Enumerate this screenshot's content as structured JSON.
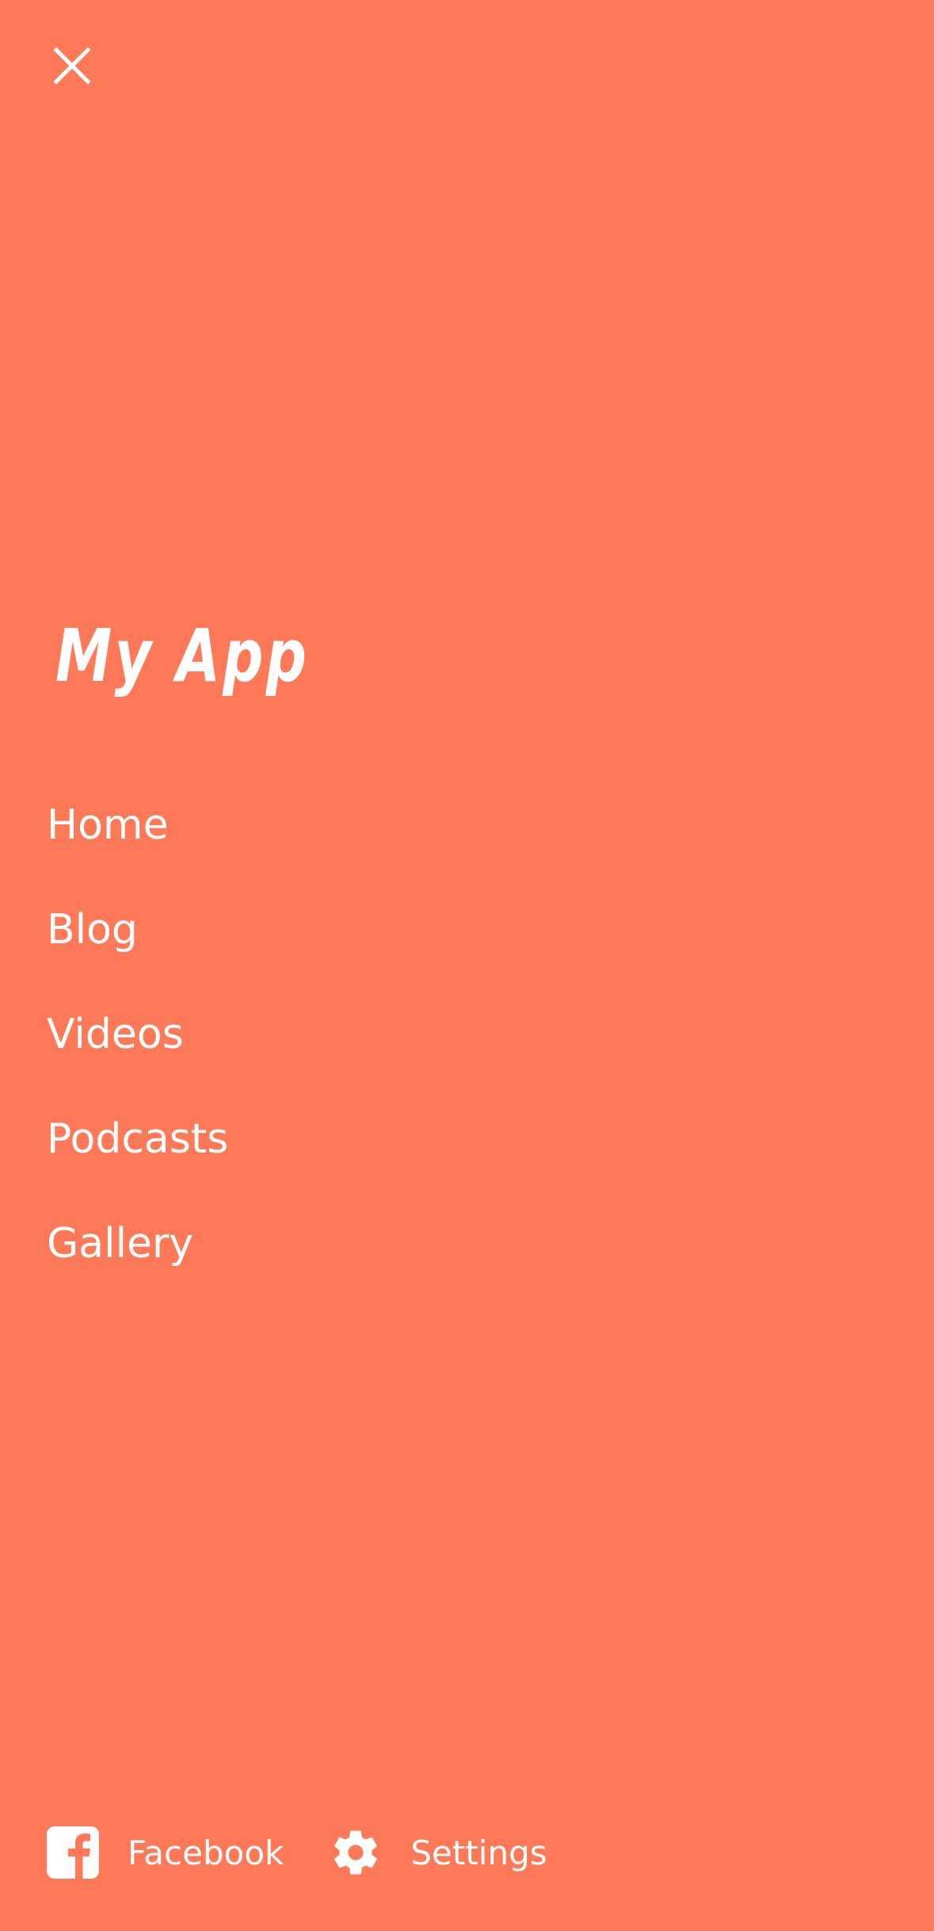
{
  "colors": {
    "background": "#FE7957",
    "foreground": "#FFFFFF"
  },
  "header": {
    "close_icon": "close-icon"
  },
  "app": {
    "title": "My App"
  },
  "nav": {
    "items": [
      {
        "label": "Home"
      },
      {
        "label": "Blog"
      },
      {
        "label": "Videos"
      },
      {
        "label": "Podcasts"
      },
      {
        "label": "Gallery"
      }
    ]
  },
  "footer": {
    "facebook": {
      "label": "Facebook",
      "icon": "facebook-icon"
    },
    "settings": {
      "label": "Settings",
      "icon": "gear-icon"
    }
  }
}
